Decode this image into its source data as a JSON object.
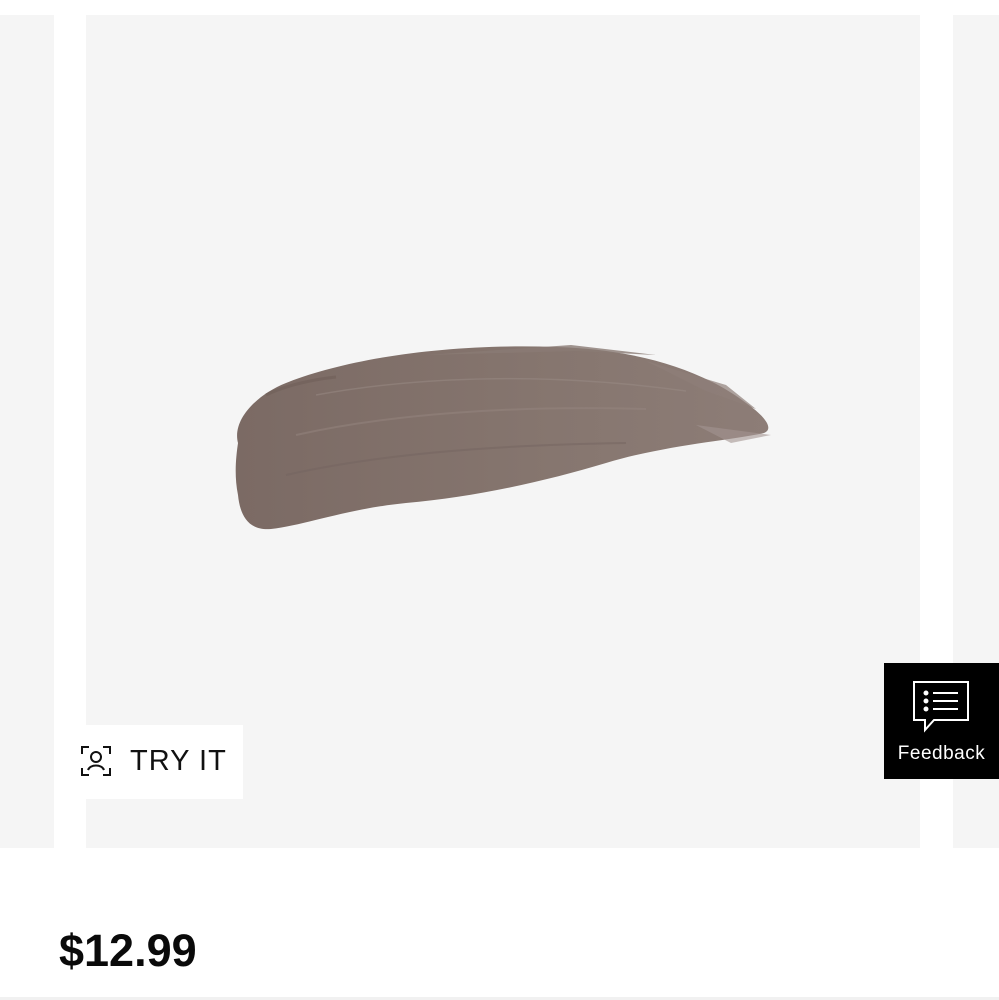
{
  "product": {
    "swatch_color": "#82726c",
    "price": "$12.99"
  },
  "try_it": {
    "label": "TRY IT",
    "icon": "face-scan-icon"
  },
  "feedback": {
    "label": "Feedback",
    "icon": "chat-list-icon"
  },
  "colors": {
    "slide_background": "#f5f5f5",
    "feedback_background": "#000000",
    "text_primary": "#111111"
  }
}
